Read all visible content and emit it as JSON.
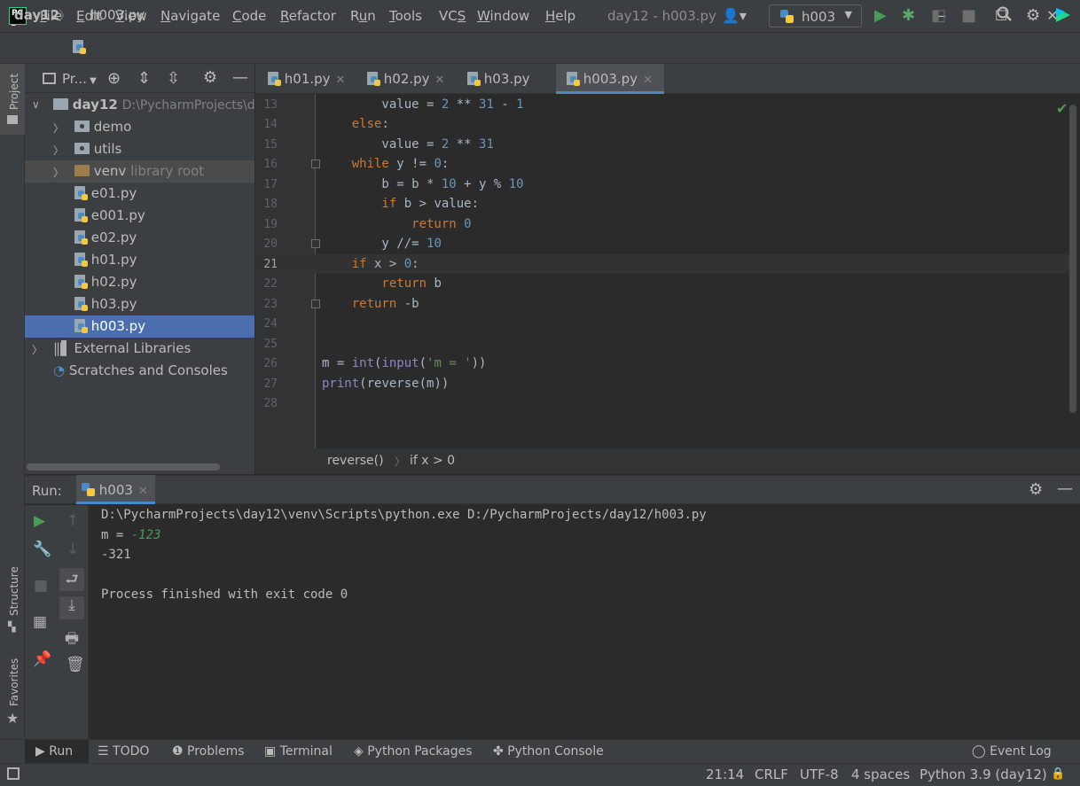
{
  "window": {
    "title": "day12 - h003.py",
    "minimize": "—",
    "maximize": "☐",
    "close": "✕"
  },
  "menu": [
    "File",
    "Edit",
    "View",
    "Navigate",
    "Code",
    "Refactor",
    "Run",
    "Tools",
    "VCS",
    "Window",
    "Help"
  ],
  "navbar": {
    "project": "day12",
    "file": "h003.py",
    "run_config": "h003"
  },
  "project_panel": {
    "title": "Pr...",
    "root": {
      "name": "day12",
      "path": "D:\\PycharmProjects\\day12"
    },
    "items": [
      {
        "name": "demo",
        "kind": "package"
      },
      {
        "name": "utils",
        "kind": "package"
      },
      {
        "name": "venv",
        "kind": "folder",
        "suffix": "library root"
      },
      {
        "name": "e01.py",
        "kind": "file"
      },
      {
        "name": "e001.py",
        "kind": "file"
      },
      {
        "name": "e02.py",
        "kind": "file"
      },
      {
        "name": "h01.py",
        "kind": "file"
      },
      {
        "name": "h02.py",
        "kind": "file"
      },
      {
        "name": "h03.py",
        "kind": "file"
      },
      {
        "name": "h003.py",
        "kind": "file",
        "selected": true
      }
    ],
    "external_libraries": "External Libraries",
    "scratches": "Scratches and Consoles"
  },
  "side_strip": {
    "project": "Project",
    "structure": "Structure",
    "favorites": "Favorites"
  },
  "editor_tabs": [
    {
      "label": "h01.py"
    },
    {
      "label": "h02.py"
    },
    {
      "label": "h03.py"
    },
    {
      "label": "h003.py",
      "active": true
    }
  ],
  "editor": {
    "line_numbers": [
      "13",
      "14",
      "15",
      "16",
      "17",
      "18",
      "19",
      "20",
      "21",
      "22",
      "23",
      "24",
      "25",
      "26",
      "27",
      "28"
    ],
    "current_line": "21"
  },
  "editor_breadcrumb": {
    "function": "reverse()",
    "condition": "if x > 0"
  },
  "run_panel": {
    "label": "Run:",
    "tab": "h003",
    "console": {
      "command": "D:\\PycharmProjects\\day12\\venv\\Scripts\\python.exe D:/PycharmProjects/day12/h003.py",
      "prompt": "m = ",
      "user_input": "-123",
      "output": "-321",
      "finish": "Process finished with exit code 0"
    }
  },
  "bottom_tabs": [
    "Run",
    "TODO",
    "Problems",
    "Terminal",
    "Python Packages",
    "Python Console",
    "Event Log"
  ],
  "status": {
    "position": "21:14",
    "line_sep": "CRLF",
    "encoding": "UTF-8",
    "indent": "4 spaces",
    "interpreter": "Python 3.9 (day12)"
  },
  "colors": {
    "run_green": "#499c54",
    "debug_green": "#59a869",
    "selection_blue": "#4b6eaf",
    "accent_blue": "#4a88c7"
  }
}
